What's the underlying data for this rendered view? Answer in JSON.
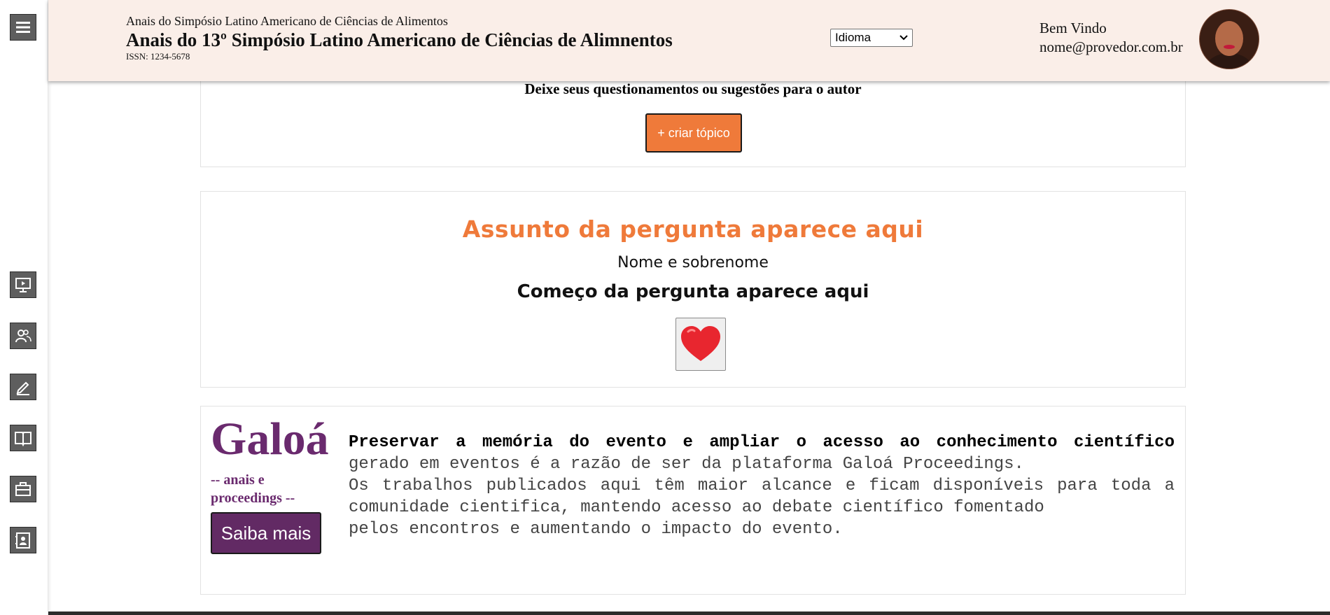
{
  "sidebar": {
    "items": [
      {
        "icon": "menu-icon",
        "name": "menu"
      },
      {
        "icon": "presentation-icon",
        "name": "presentations"
      },
      {
        "icon": "people-icon",
        "name": "people"
      },
      {
        "icon": "edit-icon",
        "name": "submit"
      },
      {
        "icon": "book-icon",
        "name": "proceedings"
      },
      {
        "icon": "briefcase-icon",
        "name": "exhibitors"
      },
      {
        "icon": "contact-card-icon",
        "name": "contacts"
      }
    ]
  },
  "header": {
    "small_title": "Anais do Simpósio Latino Americano de Ciências de Alimentos",
    "title": "Anais do 13º Simpósio Latino Americano de Ciências de Alimnentos",
    "issn": "ISSN: 1234-5678",
    "language_select": "Idioma",
    "welcome": "Bem Vindo",
    "email": "nome@provedor.com.br"
  },
  "topic_box": {
    "prompt": "Deixe seus questionamentos ou sugestões para o autor",
    "create_button": "+ criar tópico"
  },
  "question": {
    "subject": "Assunto da pergunta aparece aqui",
    "author": "Nome e sobrenome",
    "start": "Começo da pergunta aparece aqui",
    "like_icon": "heart-icon"
  },
  "galoa": {
    "logo": "Galoá",
    "tagline": "-- anais e proceedings --",
    "button": "Saiba mais",
    "bold_text": "Preservar a memória do evento e ampliar o acesso ao conhecimento científico",
    "text1": " gerado em eventos é a razão de ser da plataforma Galoá Proceedings.",
    "text2": "Os trabalhos publicados aqui têm maior alcance e ficam disponíveis para toda a comunidade cientifica, mantendo acesso ao debate científico fomentado",
    "text3": "pelos encontros e aumentando o impacto do evento."
  },
  "colors": {
    "accent_orange": "#ef7a3a",
    "galoa_purple": "#622a64",
    "header_bg": "#faeee8"
  }
}
